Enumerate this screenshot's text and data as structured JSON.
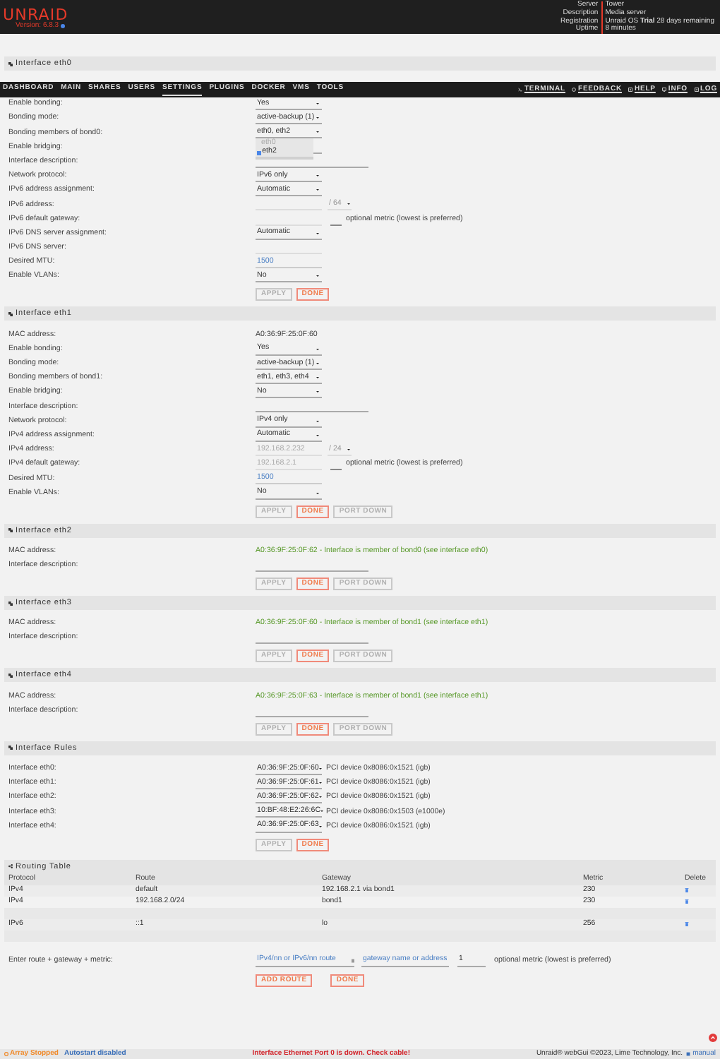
{
  "header": {
    "logo": "UNRAID",
    "version": "Version: 6.8.3",
    "info": [
      {
        "label": "Server",
        "value": "Tower"
      },
      {
        "label": "Description",
        "value": "Media server"
      },
      {
        "label": "Registration",
        "value": "Unraid OS **Trial** 28 days remaining"
      },
      {
        "label": "Uptime",
        "value": "8 minutes"
      }
    ]
  },
  "nav": {
    "items": [
      {
        "label": "DASHBOARD",
        "selected": false
      },
      {
        "label": "MAIN",
        "selected": false
      },
      {
        "label": "SHARES",
        "selected": false
      },
      {
        "label": "USERS",
        "selected": false
      },
      {
        "label": "SETTINGS",
        "selected": true
      },
      {
        "label": "PLUGINS",
        "selected": false
      },
      {
        "label": "DOCKER",
        "selected": false
      },
      {
        "label": "VMS",
        "selected": false
      },
      {
        "label": "TOOLS",
        "selected": false
      }
    ],
    "tools": [
      {
        "label": "TERMINAL",
        "kind": "terminal"
      },
      {
        "label": "FEEDBACK",
        "kind": "feedback"
      },
      {
        "label": "HELP",
        "kind": "help"
      },
      {
        "label": "INFO",
        "kind": "info"
      },
      {
        "label": "LOG",
        "kind": "log"
      }
    ]
  },
  "sections": [
    {
      "title": "Interface eth0",
      "rows": [
        {
          "label": "Enable bonding:",
          "kind": "select",
          "value": "Yes"
        },
        {
          "label": "Bonding mode:",
          "kind": "select",
          "value": "active-backup (1)"
        },
        {
          "label": "Bonding members of bond0:",
          "kind": "select",
          "value": "eth0, eth2",
          "open": true,
          "options": [
            {
              "label": "eth0",
              "disabled": true,
              "checked": false
            },
            {
              "label": "eth2",
              "disabled": false,
              "checked": true
            }
          ]
        },
        {
          "label": "Enable bridging:",
          "kind": "select"
        },
        {
          "label": "Interface description:",
          "kind": "description"
        },
        {
          "label": "Network protocol:",
          "kind": "select",
          "value": "IPv6 only"
        },
        {
          "label": "IPv6 address assignment:",
          "kind": "select",
          "value": "Automatic"
        },
        {
          "label": "IPv6 address:",
          "kind": "ip",
          "disabled": true,
          "cidr": "/ 64"
        },
        {
          "label": "IPv6 default gateway:",
          "kind": "gateway",
          "disabled": true,
          "note": "optional metric (lowest is preferred)"
        },
        {
          "label": "IPv6 DNS server assignment:",
          "kind": "select",
          "value": "Automatic"
        },
        {
          "label": "IPv6 DNS server:",
          "kind": "input",
          "disabled": true
        },
        {
          "label": "Desired MTU:",
          "kind": "input",
          "value": "1500",
          "disabled": false
        },
        {
          "label": "Enable VLANs:",
          "kind": "select",
          "value": "No"
        }
      ],
      "buttons": [
        {
          "label": "APPLY",
          "kind": "plain",
          "disabled": true
        },
        {
          "label": "DONE",
          "kind": "done",
          "disabled": false
        }
      ]
    },
    {
      "title": "Interface eth1",
      "rows": [
        {
          "label": "MAC address:",
          "kind": "text",
          "value": "A0:36:9F:25:0F:60"
        },
        {
          "label": "Enable bonding:",
          "kind": "select",
          "value": "Yes"
        },
        {
          "label": "Bonding mode:",
          "kind": "select",
          "value": "active-backup (1)"
        },
        {
          "label": "Bonding members of bond1:",
          "kind": "select",
          "value": "eth1, eth3, eth4"
        },
        {
          "label": "Enable bridging:",
          "kind": "select",
          "value": "No"
        },
        {
          "label": "Interface description:",
          "kind": "description"
        },
        {
          "label": "Network protocol:",
          "kind": "select",
          "value": "IPv4 only"
        },
        {
          "label": "IPv4 address assignment:",
          "kind": "select",
          "value": "Automatic"
        },
        {
          "label": "IPv4 address:",
          "kind": "ip",
          "value": "192.168.2.232",
          "disabled": true,
          "cidr": "/ 24"
        },
        {
          "label": "IPv4 default gateway:",
          "kind": "gateway",
          "value": "192.168.2.1",
          "disabled": true,
          "note": "optional metric (lowest is preferred)"
        },
        {
          "label": "Desired MTU:",
          "kind": "input",
          "value": "1500",
          "disabled": false
        },
        {
          "label": "Enable VLANs:",
          "kind": "select",
          "value": "No"
        }
      ],
      "buttons": [
        {
          "label": "APPLY",
          "kind": "plain",
          "disabled": true
        },
        {
          "label": "DONE",
          "kind": "done",
          "disabled": false
        },
        {
          "label": "PORT DOWN",
          "kind": "plain",
          "disabled": true
        }
      ]
    },
    {
      "title": "Interface eth2",
      "rows": [
        {
          "label": "MAC address:",
          "kind": "note",
          "value": "A0:36:9F:25:0F:62 - Interface is member of bond0 (see interface eth0)"
        },
        {
          "label": "Interface description:",
          "kind": "description"
        }
      ],
      "buttons": [
        {
          "label": "APPLY",
          "kind": "plain",
          "disabled": true
        },
        {
          "label": "DONE",
          "kind": "done",
          "disabled": false
        },
        {
          "label": "PORT DOWN",
          "kind": "plain",
          "disabled": true
        }
      ]
    },
    {
      "title": "Interface eth3",
      "rows": [
        {
          "label": "MAC address:",
          "kind": "note",
          "value": "A0:36:9F:25:0F:60 - Interface is member of bond1 (see interface eth1)"
        },
        {
          "label": "Interface description:",
          "kind": "description"
        }
      ],
      "buttons": [
        {
          "label": "APPLY",
          "kind": "plain",
          "disabled": true
        },
        {
          "label": "DONE",
          "kind": "done",
          "disabled": false
        },
        {
          "label": "PORT DOWN",
          "kind": "plain",
          "disabled": true
        }
      ]
    },
    {
      "title": "Interface eth4",
      "rows": [
        {
          "label": "MAC address:",
          "kind": "note",
          "value": "A0:36:9F:25:0F:63 - Interface is member of bond1 (see interface eth1)"
        },
        {
          "label": "Interface description:",
          "kind": "description"
        }
      ],
      "buttons": [
        {
          "label": "APPLY",
          "kind": "plain",
          "disabled": true
        },
        {
          "label": "DONE",
          "kind": "done",
          "disabled": false
        },
        {
          "label": "PORT DOWN",
          "kind": "plain",
          "disabled": true
        }
      ]
    },
    {
      "title": "Interface Rules",
      "rows": [
        {
          "label": "Interface eth0:",
          "kind": "rule",
          "value": "A0:36:9F:25:0F:60",
          "device": "PCI device 0x8086:0x1521 (igb)"
        },
        {
          "label": "Interface eth1:",
          "kind": "rule",
          "value": "A0:36:9F:25:0F:61",
          "device": "PCI device 0x8086:0x1521 (igb)"
        },
        {
          "label": "Interface eth2:",
          "kind": "rule",
          "value": "A0:36:9F:25:0F:62",
          "device": "PCI device 0x8086:0x1521 (igb)"
        },
        {
          "label": "Interface eth3:",
          "kind": "rule",
          "value": "10:BF:48:E2:26:6C",
          "device": "PCI device 0x8086:0x1503 (e1000e)"
        },
        {
          "label": "Interface eth4:",
          "kind": "rule",
          "value": "A0:36:9F:25:0F:63",
          "device": "PCI device 0x8086:0x1521 (igb)"
        }
      ],
      "buttons": [
        {
          "label": "APPLY",
          "kind": "plain",
          "disabled": true
        },
        {
          "label": "DONE",
          "kind": "done",
          "disabled": false
        }
      ]
    }
  ],
  "routing": {
    "title": "Routing Table",
    "columns": [
      "Protocol",
      "Route",
      "Gateway",
      "Metric",
      "Delete"
    ],
    "groups": [
      {
        "rows": [
          [
            "IPv4",
            "default",
            "192.168.2.1 via bond1",
            "230"
          ],
          [
            "IPv4",
            "192.168.2.0/24",
            "bond1",
            "230"
          ]
        ]
      },
      {
        "rows": [
          [
            "IPv6",
            "::1",
            "lo",
            "256"
          ]
        ]
      }
    ],
    "entry": {
      "label": "Enter route + gateway + metric:",
      "route_placeholder": "IPv4/nn or IPv6/nn route",
      "gateway_placeholder": "gateway name or address",
      "metric": "1",
      "note": "optional metric (lowest is preferred)"
    },
    "buttons": [
      {
        "label": "ADD ROUTE",
        "kind": "done",
        "disabled": false
      },
      {
        "label": "DONE",
        "kind": "done",
        "disabled": false
      }
    ]
  },
  "footer": {
    "array": "Array Stopped",
    "autostart": "Autostart disabled",
    "message": "Interface Ethernet Port 0 is down. Check cable!",
    "copyright": "Unraid® webGui ©2023, Lime Technology, Inc.",
    "manual": "manual"
  }
}
